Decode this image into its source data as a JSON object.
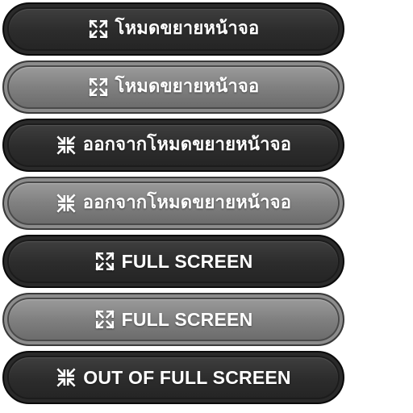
{
  "buttons": [
    {
      "label": "โหมดขยายหน้าจอ",
      "style": "dark",
      "icon": "expand-icon",
      "script": "thai"
    },
    {
      "label": "โหมดขยายหน้าจอ",
      "style": "light",
      "icon": "expand-icon",
      "script": "thai"
    },
    {
      "label": "ออกจากโหมดขยายหน้าจอ",
      "style": "dark",
      "icon": "collapse-icon",
      "script": "thai"
    },
    {
      "label": "ออกจากโหมดขยายหน้าจอ",
      "style": "light",
      "icon": "collapse-icon",
      "script": "thai"
    },
    {
      "label": "FULL SCREEN",
      "style": "dark",
      "icon": "expand-icon",
      "script": "latin"
    },
    {
      "label": "FULL SCREEN",
      "style": "light",
      "icon": "expand-icon",
      "script": "latin"
    },
    {
      "label": "OUT OF FULL SCREEN",
      "style": "dark",
      "icon": "collapse-icon",
      "script": "latin"
    }
  ],
  "colors": {
    "dark_button": "#2c2c2c",
    "light_button": "#808080",
    "text": "#ffffff"
  }
}
